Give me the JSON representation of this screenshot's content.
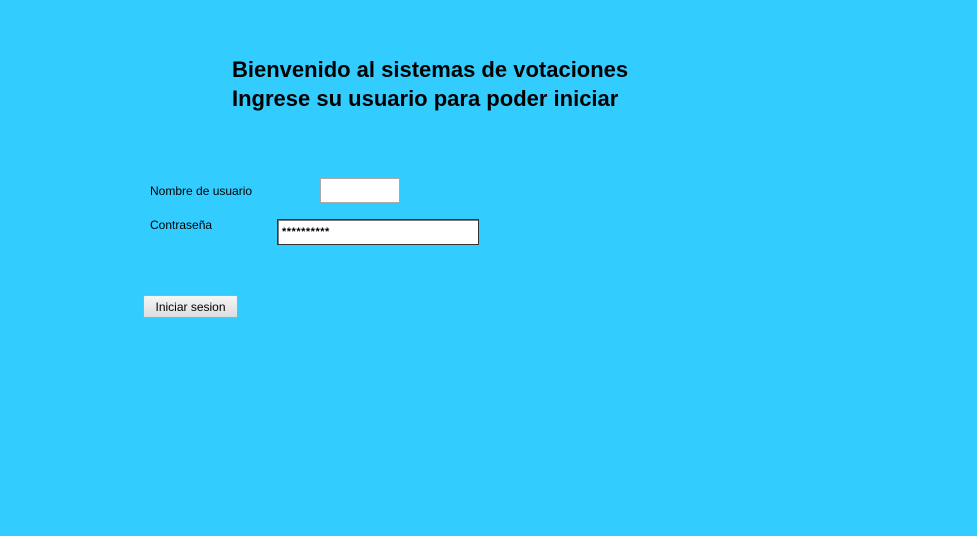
{
  "header": {
    "welcome": "Bienvenido al sistemas de votaciones",
    "instruction": "Ingrese su usuario para poder iniciar"
  },
  "form": {
    "username_label": "Nombre de usuario",
    "username_value": "",
    "password_label": "Contraseña",
    "password_value": "**********",
    "submit_label": "Iniciar sesion"
  },
  "colors": {
    "background": "#33ccff"
  }
}
